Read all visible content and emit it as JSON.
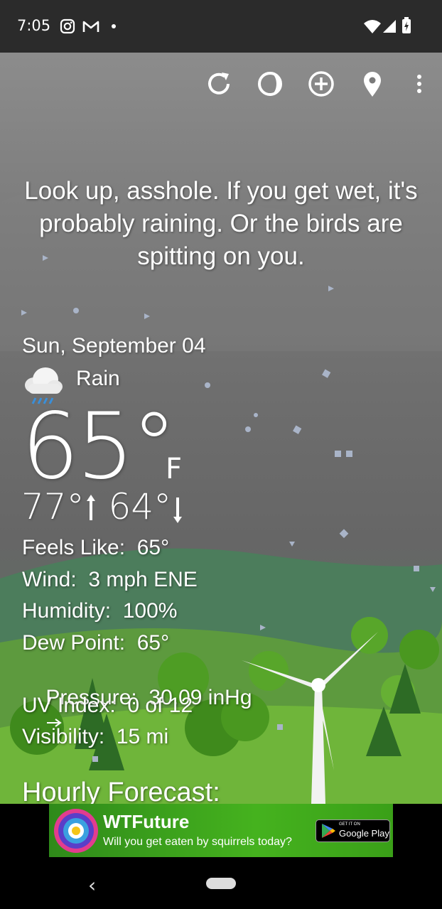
{
  "status_bar": {
    "time": "7:05",
    "left_icons": [
      "instagram-icon",
      "gmail-icon",
      "dot-icon"
    ],
    "right_icons": [
      "wifi-icon",
      "signal-icon",
      "battery-charging-icon"
    ]
  },
  "toolbar": {
    "icons": [
      "refresh-icon",
      "theme-icon",
      "add-location-icon",
      "location-pin-icon",
      "more-icon"
    ]
  },
  "quote": "Look up, asshole. If you get wet, it's probably raining. Or the birds are spitting on you.",
  "weather": {
    "date": "Sun, September 04",
    "condition": "Rain",
    "condition_icon": "rain-cloud-icon",
    "temperature": "65°",
    "unit": "F",
    "high": "77°",
    "low": "64°",
    "details": {
      "feels_like": "Feels Like:  65°",
      "wind": "Wind:  3 mph ENE",
      "humidity": "Humidity:  100%",
      "dew_point": "Dew Point:  65°",
      "pressure": "Pressure:  30.09 inHg",
      "uv_index": "UV Index:  0 of 12",
      "visibility": "Visibility:  15 mi"
    },
    "hourly_title": "Hourly Forecast:"
  },
  "ad": {
    "title": "WTFuture",
    "subtitle": "Will you get eaten by squirrels today?",
    "store_small": "GET IT ON",
    "store_big": "Google Play"
  },
  "colors": {
    "status_bar": "#2b2b2b",
    "ad_green": "#45b21e",
    "rain_blue": "#3a8fd9"
  }
}
